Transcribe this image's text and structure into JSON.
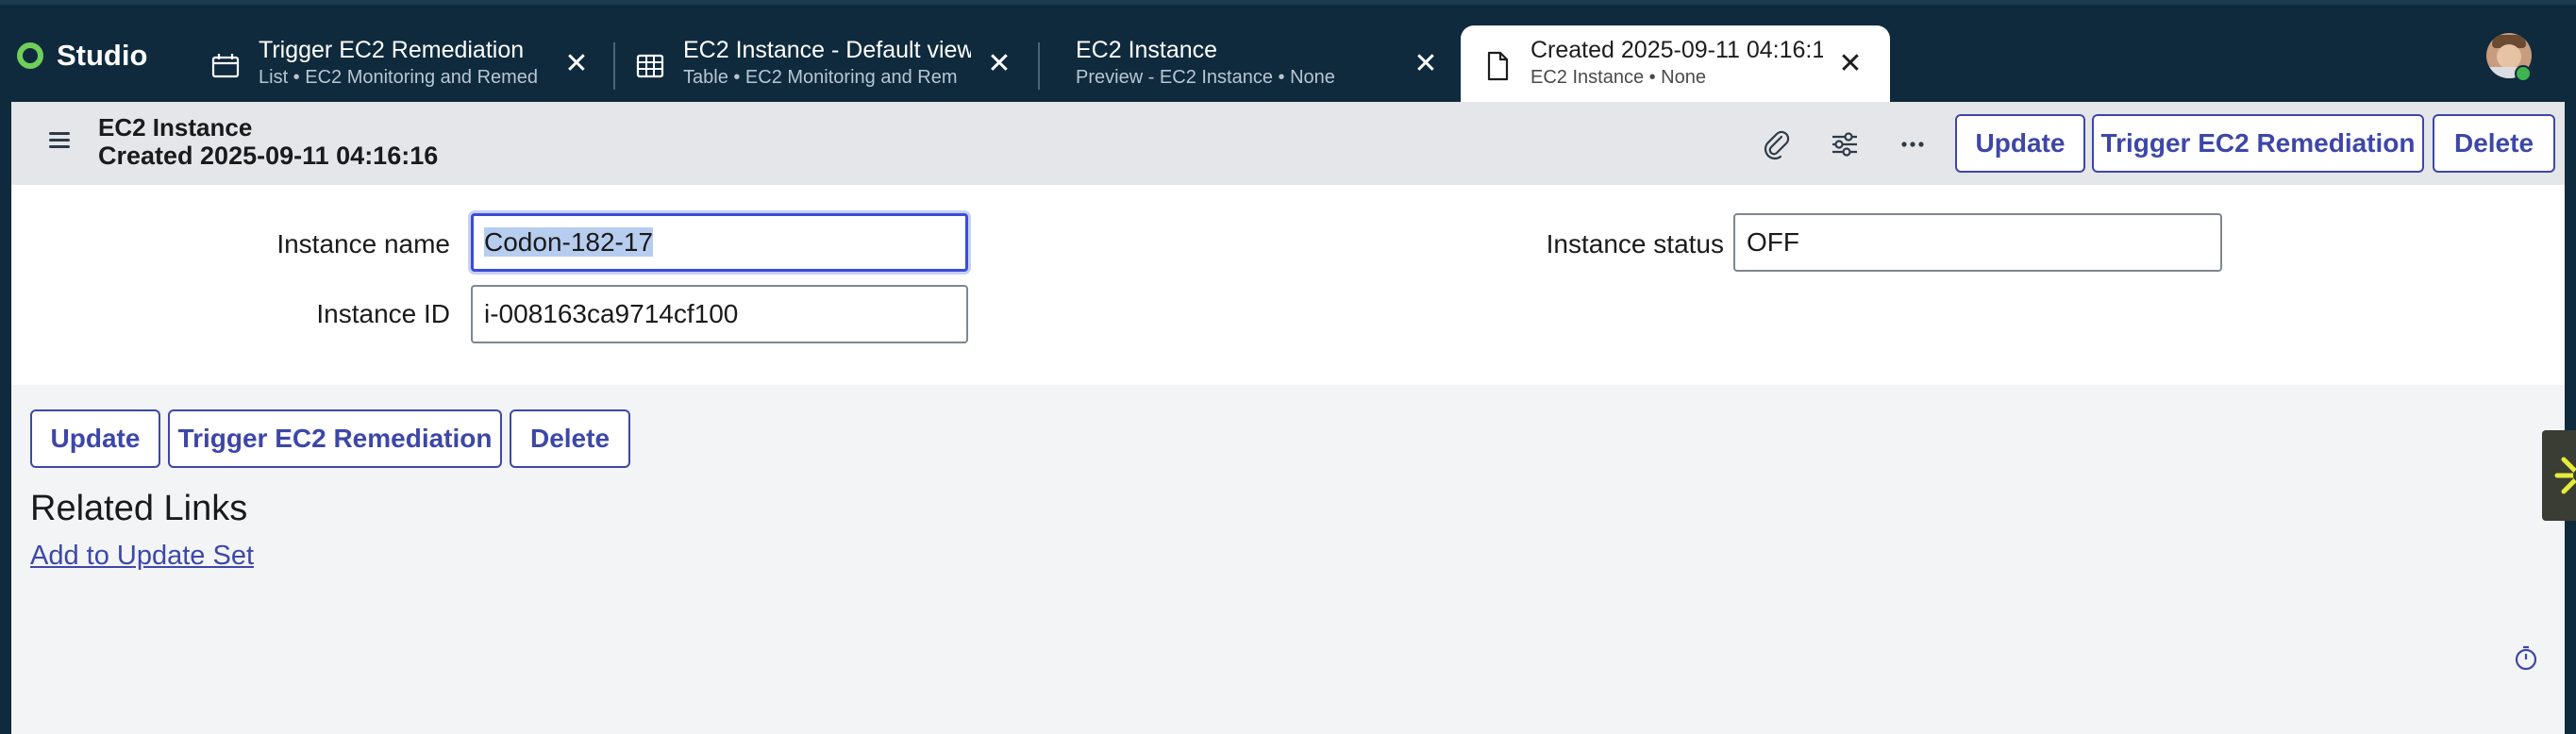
{
  "app": {
    "brand": "Studio"
  },
  "tabs": [
    {
      "title": "Trigger EC2 Remediation",
      "subtitle": "List • EC2 Monitoring and Remed",
      "icon": "list-icon"
    },
    {
      "title": "EC2 Instance - Default view",
      "subtitle": "Table • EC2 Monitoring and Rem",
      "icon": "table-icon"
    },
    {
      "title": "EC2 Instance",
      "subtitle": "Preview - EC2 Instance • None",
      "icon": ""
    },
    {
      "title": "Created 2025-09-11 04:16:1",
      "subtitle": "EC2 Instance • None",
      "icon": "document-icon",
      "active": true
    }
  ],
  "record": {
    "type": "EC2 Instance",
    "name": "Created 2025-09-11 04:16:16",
    "actions": {
      "update": "Update",
      "trigger": "Trigger EC2 Remediation",
      "delete": "Delete"
    }
  },
  "form": {
    "instance_name_label": "Instance name",
    "instance_name_value": "Codon-182-17",
    "instance_id_label": "Instance ID",
    "instance_id_value": "i-008163ca9714cf100",
    "instance_status_label": "Instance status",
    "instance_status_value": "OFF"
  },
  "bottom_actions": {
    "update": "Update",
    "trigger": "Trigger EC2 Remediation",
    "delete": "Delete"
  },
  "related_links": {
    "heading": "Related Links",
    "add_to_update_set": "Add to Update Set"
  },
  "colors": {
    "header_bg": "#0f2a3d",
    "accent": "#3d47a8",
    "brand_green": "#6fcf5a",
    "widget_yellow": "#e6ec3b"
  }
}
